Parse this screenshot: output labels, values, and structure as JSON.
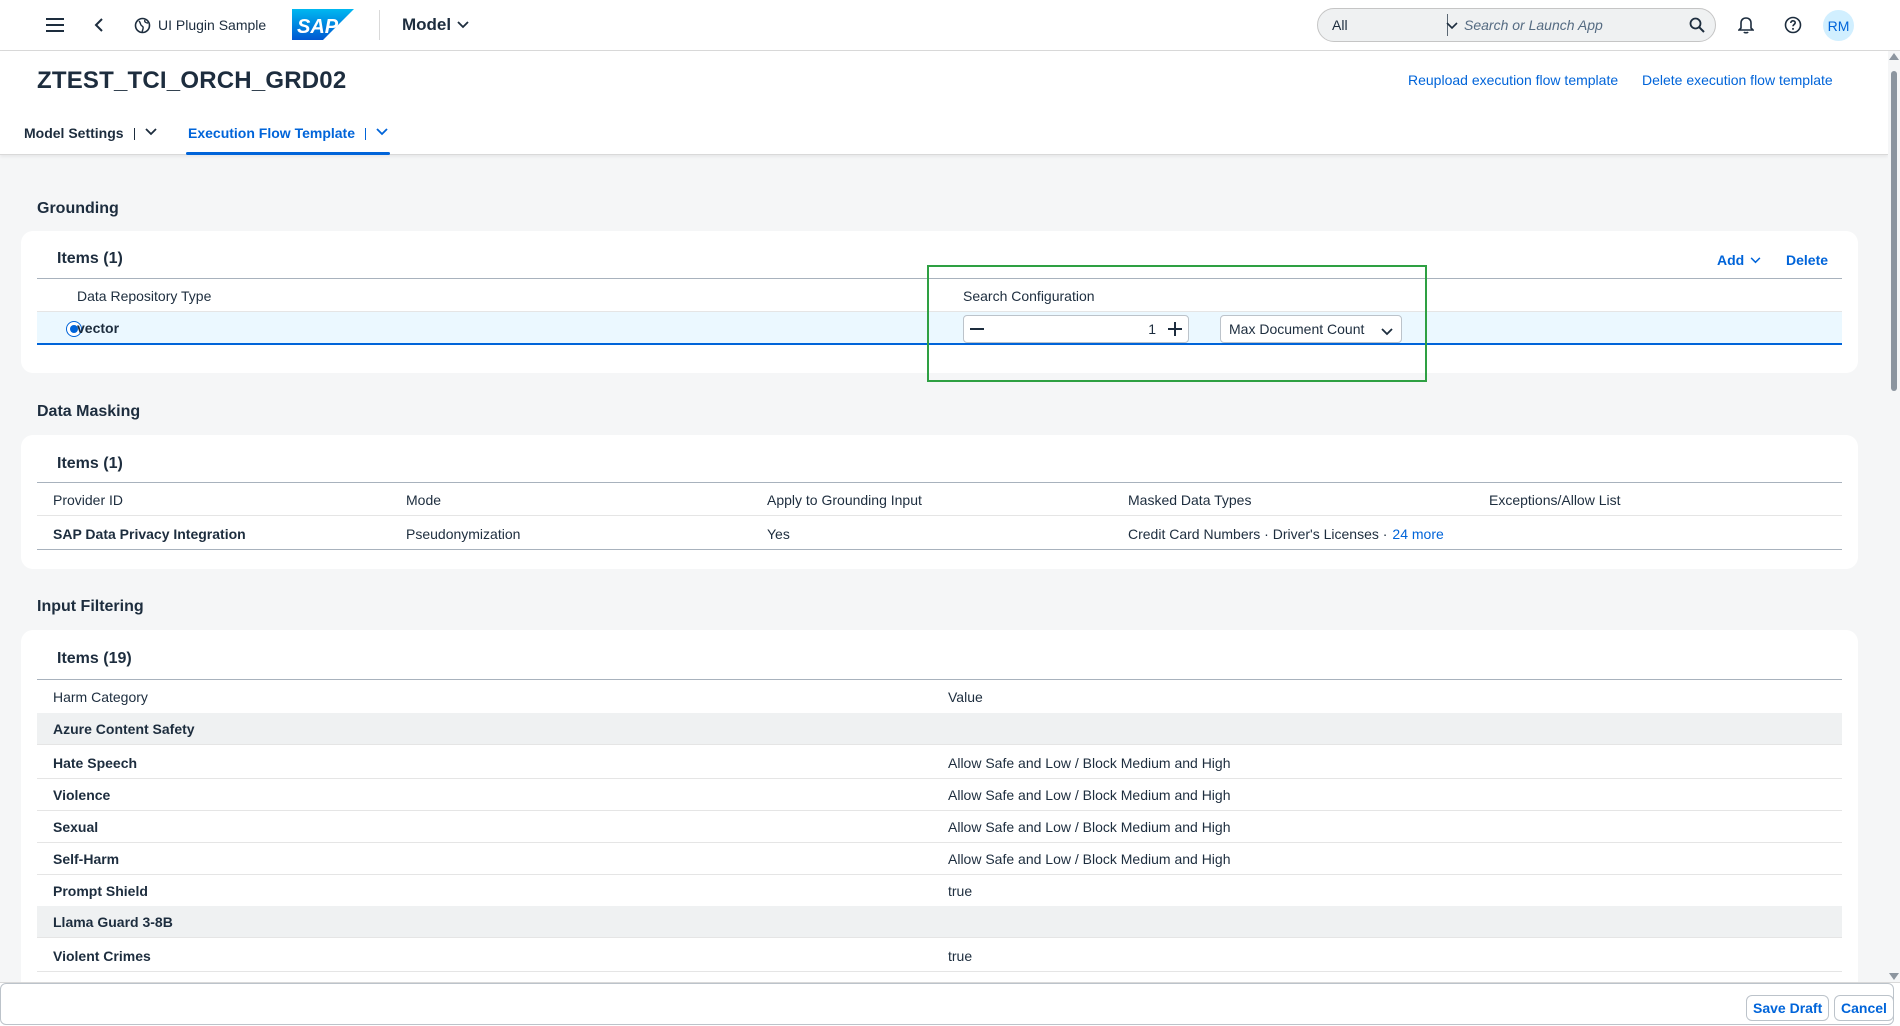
{
  "shell": {
    "app_name": "UI Plugin Sample",
    "model_menu": "Model",
    "search_scope": "All",
    "search_placeholder": "Search or Launch App",
    "avatar_initials": "RM",
    "brand_logo_text": "SAP",
    "brand_color": "#0070f2"
  },
  "header": {
    "title": "ZTEST_TCI_ORCH_GRD02",
    "actions": [
      "Reupload execution flow template",
      "Delete execution flow template"
    ],
    "tabs": [
      {
        "label": "Model Settings",
        "active": false
      },
      {
        "label": "Execution Flow Template",
        "active": true
      }
    ]
  },
  "grounding": {
    "section_title": "Grounding",
    "items_title": "Items (1)",
    "add_label": "Add",
    "delete_label": "Delete",
    "columns": [
      "Data Repository Type",
      "Search Configuration"
    ],
    "row": {
      "type": "vector",
      "stepper_value": "1",
      "select_value": "Max Document Count"
    }
  },
  "data_masking": {
    "section_title": "Data Masking",
    "items_title": "Items (1)",
    "columns": [
      "Provider ID",
      "Mode",
      "Apply to Grounding Input",
      "Masked Data Types",
      "Exceptions/Allow List"
    ],
    "row": {
      "provider": "SAP Data Privacy Integration",
      "mode": "Pseudonymization",
      "apply": "Yes",
      "types": "Credit Card Numbers · Driver's Licenses ·",
      "more_link": "24 more",
      "exceptions": ""
    }
  },
  "input_filtering": {
    "section_title": "Input Filtering",
    "items_title": "Items (19)",
    "columns": [
      "Harm Category",
      "Value"
    ],
    "rows": [
      {
        "category": "Azure Content Safety",
        "value": "",
        "group": true
      },
      {
        "category": "Hate Speech",
        "value": "Allow Safe and Low / Block Medium and High",
        "group": false
      },
      {
        "category": "Violence",
        "value": "Allow Safe and Low / Block Medium and High",
        "group": false
      },
      {
        "category": "Sexual",
        "value": "Allow Safe and Low / Block Medium and High",
        "group": false
      },
      {
        "category": "Self-Harm",
        "value": "Allow Safe and Low / Block Medium and High",
        "group": false
      },
      {
        "category": "Prompt Shield",
        "value": "true",
        "group": false
      },
      {
        "category": "Llama Guard 3-8B",
        "value": "",
        "group": true
      },
      {
        "category": "Violent Crimes",
        "value": "true",
        "group": false
      }
    ]
  },
  "footer": {
    "save_draft": "Save Draft",
    "cancel": "Cancel"
  }
}
